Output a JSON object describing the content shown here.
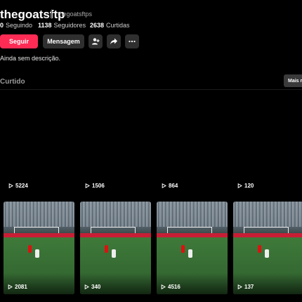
{
  "profile": {
    "username": "thegoatsftp",
    "nickname": "thegoatsftps",
    "following_count": "0",
    "following_label": "Seguindo",
    "followers_count": "1138",
    "followers_label": "Seguidores",
    "likes_count": "2638",
    "likes_label": "Curtidas",
    "bio": "Ainda sem descrição."
  },
  "actions": {
    "follow_label": "Seguir",
    "message_label": "Mensagem",
    "add_friend_icon": "person-add-icon",
    "share_icon": "share-arrow-icon",
    "more_icon": "ellipsis-icon"
  },
  "tabs": {
    "liked_label": "Curtido",
    "more_button_label": "Mais r"
  },
  "videos_row1": [
    {
      "views": "5224"
    },
    {
      "views": "1506"
    },
    {
      "views": "864"
    },
    {
      "views": "120"
    }
  ],
  "videos_row2": [
    {
      "views": "2081"
    },
    {
      "views": "340"
    },
    {
      "views": "4516"
    },
    {
      "views": "137"
    }
  ],
  "colors": {
    "accent": "#fe2c55",
    "background": "#000000",
    "button_secondary": "#2f2f2f"
  }
}
